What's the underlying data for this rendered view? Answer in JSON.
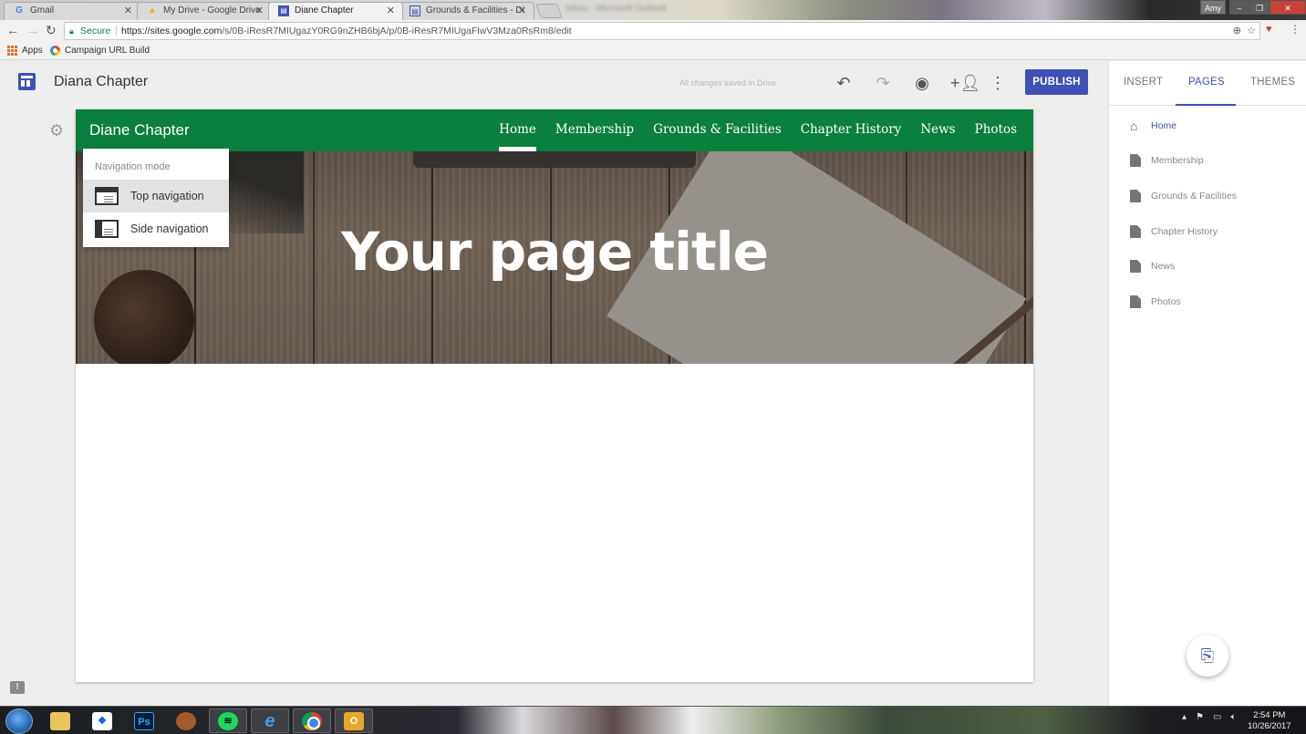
{
  "browser": {
    "tabs": [
      {
        "label": "Gmail",
        "icon": "gmail-icon",
        "active": false
      },
      {
        "label": "My Drive - Google Drive",
        "icon": "drive-icon",
        "active": false
      },
      {
        "label": "Diane Chapter",
        "icon": "sites-icon",
        "active": true
      },
      {
        "label": "Grounds & Facilities - Di",
        "icon": "sites-icon",
        "active": false
      }
    ],
    "background_window_title": "Inbox - Microsoft Outlook",
    "window_user": "Amy",
    "address": {
      "secure_label": "Secure",
      "url_host": "https://sites.google.com",
      "url_path": "/s/0B-iResR7MIUgazY0RG9nZHB6bjA/p/0B-iResR7MIUgaFlwV3Mza0RsRm8/edit"
    },
    "bookmarks": [
      {
        "label": "Apps",
        "icon": "apps-grid-icon"
      },
      {
        "label": "Campaign URL Build",
        "icon": "campaign-url-builder-icon"
      }
    ]
  },
  "editor": {
    "doc_title": "Diana Chapter",
    "save_status": "All changes saved in Drive",
    "toolbar": {
      "undo": "undo-icon",
      "redo": "redo-icon",
      "preview": "preview-eye-icon",
      "share": "add-person-icon",
      "more": "more-vert-icon",
      "publish_label": "PUBLISH"
    },
    "accent_color": "#3f51b5"
  },
  "site": {
    "name": "Diane Chapter",
    "header_color": "#0b7f3d",
    "nav": [
      {
        "label": "Home",
        "active": true
      },
      {
        "label": "Membership",
        "active": false
      },
      {
        "label": "Grounds & Facilities",
        "active": false
      },
      {
        "label": "Chapter History",
        "active": false
      },
      {
        "label": "News",
        "active": false
      },
      {
        "label": "Photos",
        "active": false
      }
    ],
    "page_title": "Your page title"
  },
  "navigation_mode_menu": {
    "label": "Navigation mode",
    "options": [
      {
        "label": "Top navigation",
        "selected": true
      },
      {
        "label": "Side navigation",
        "selected": false
      }
    ]
  },
  "right_panel": {
    "tabs": [
      {
        "label": "INSERT",
        "active": false
      },
      {
        "label": "PAGES",
        "active": true
      },
      {
        "label": "THEMES",
        "active": false
      }
    ],
    "pages": [
      {
        "label": "Home",
        "icon": "home-icon",
        "home": true
      },
      {
        "label": "Membership",
        "icon": "page-icon",
        "home": false
      },
      {
        "label": "Grounds & Facilities",
        "icon": "page-icon",
        "home": false
      },
      {
        "label": "Chapter History",
        "icon": "page-icon",
        "home": false
      },
      {
        "label": "News",
        "icon": "page-icon",
        "home": false
      },
      {
        "label": "Photos",
        "icon": "page-icon",
        "home": false
      }
    ],
    "fab_icon": "add-page-icon"
  },
  "taskbar": {
    "apps": [
      "start",
      "file-explorer",
      "dropbox",
      "photoshop",
      "app",
      "spotify",
      "internet-explorer",
      "chrome",
      "outlook"
    ],
    "time": "2:54 PM",
    "date": "10/26/2017"
  }
}
